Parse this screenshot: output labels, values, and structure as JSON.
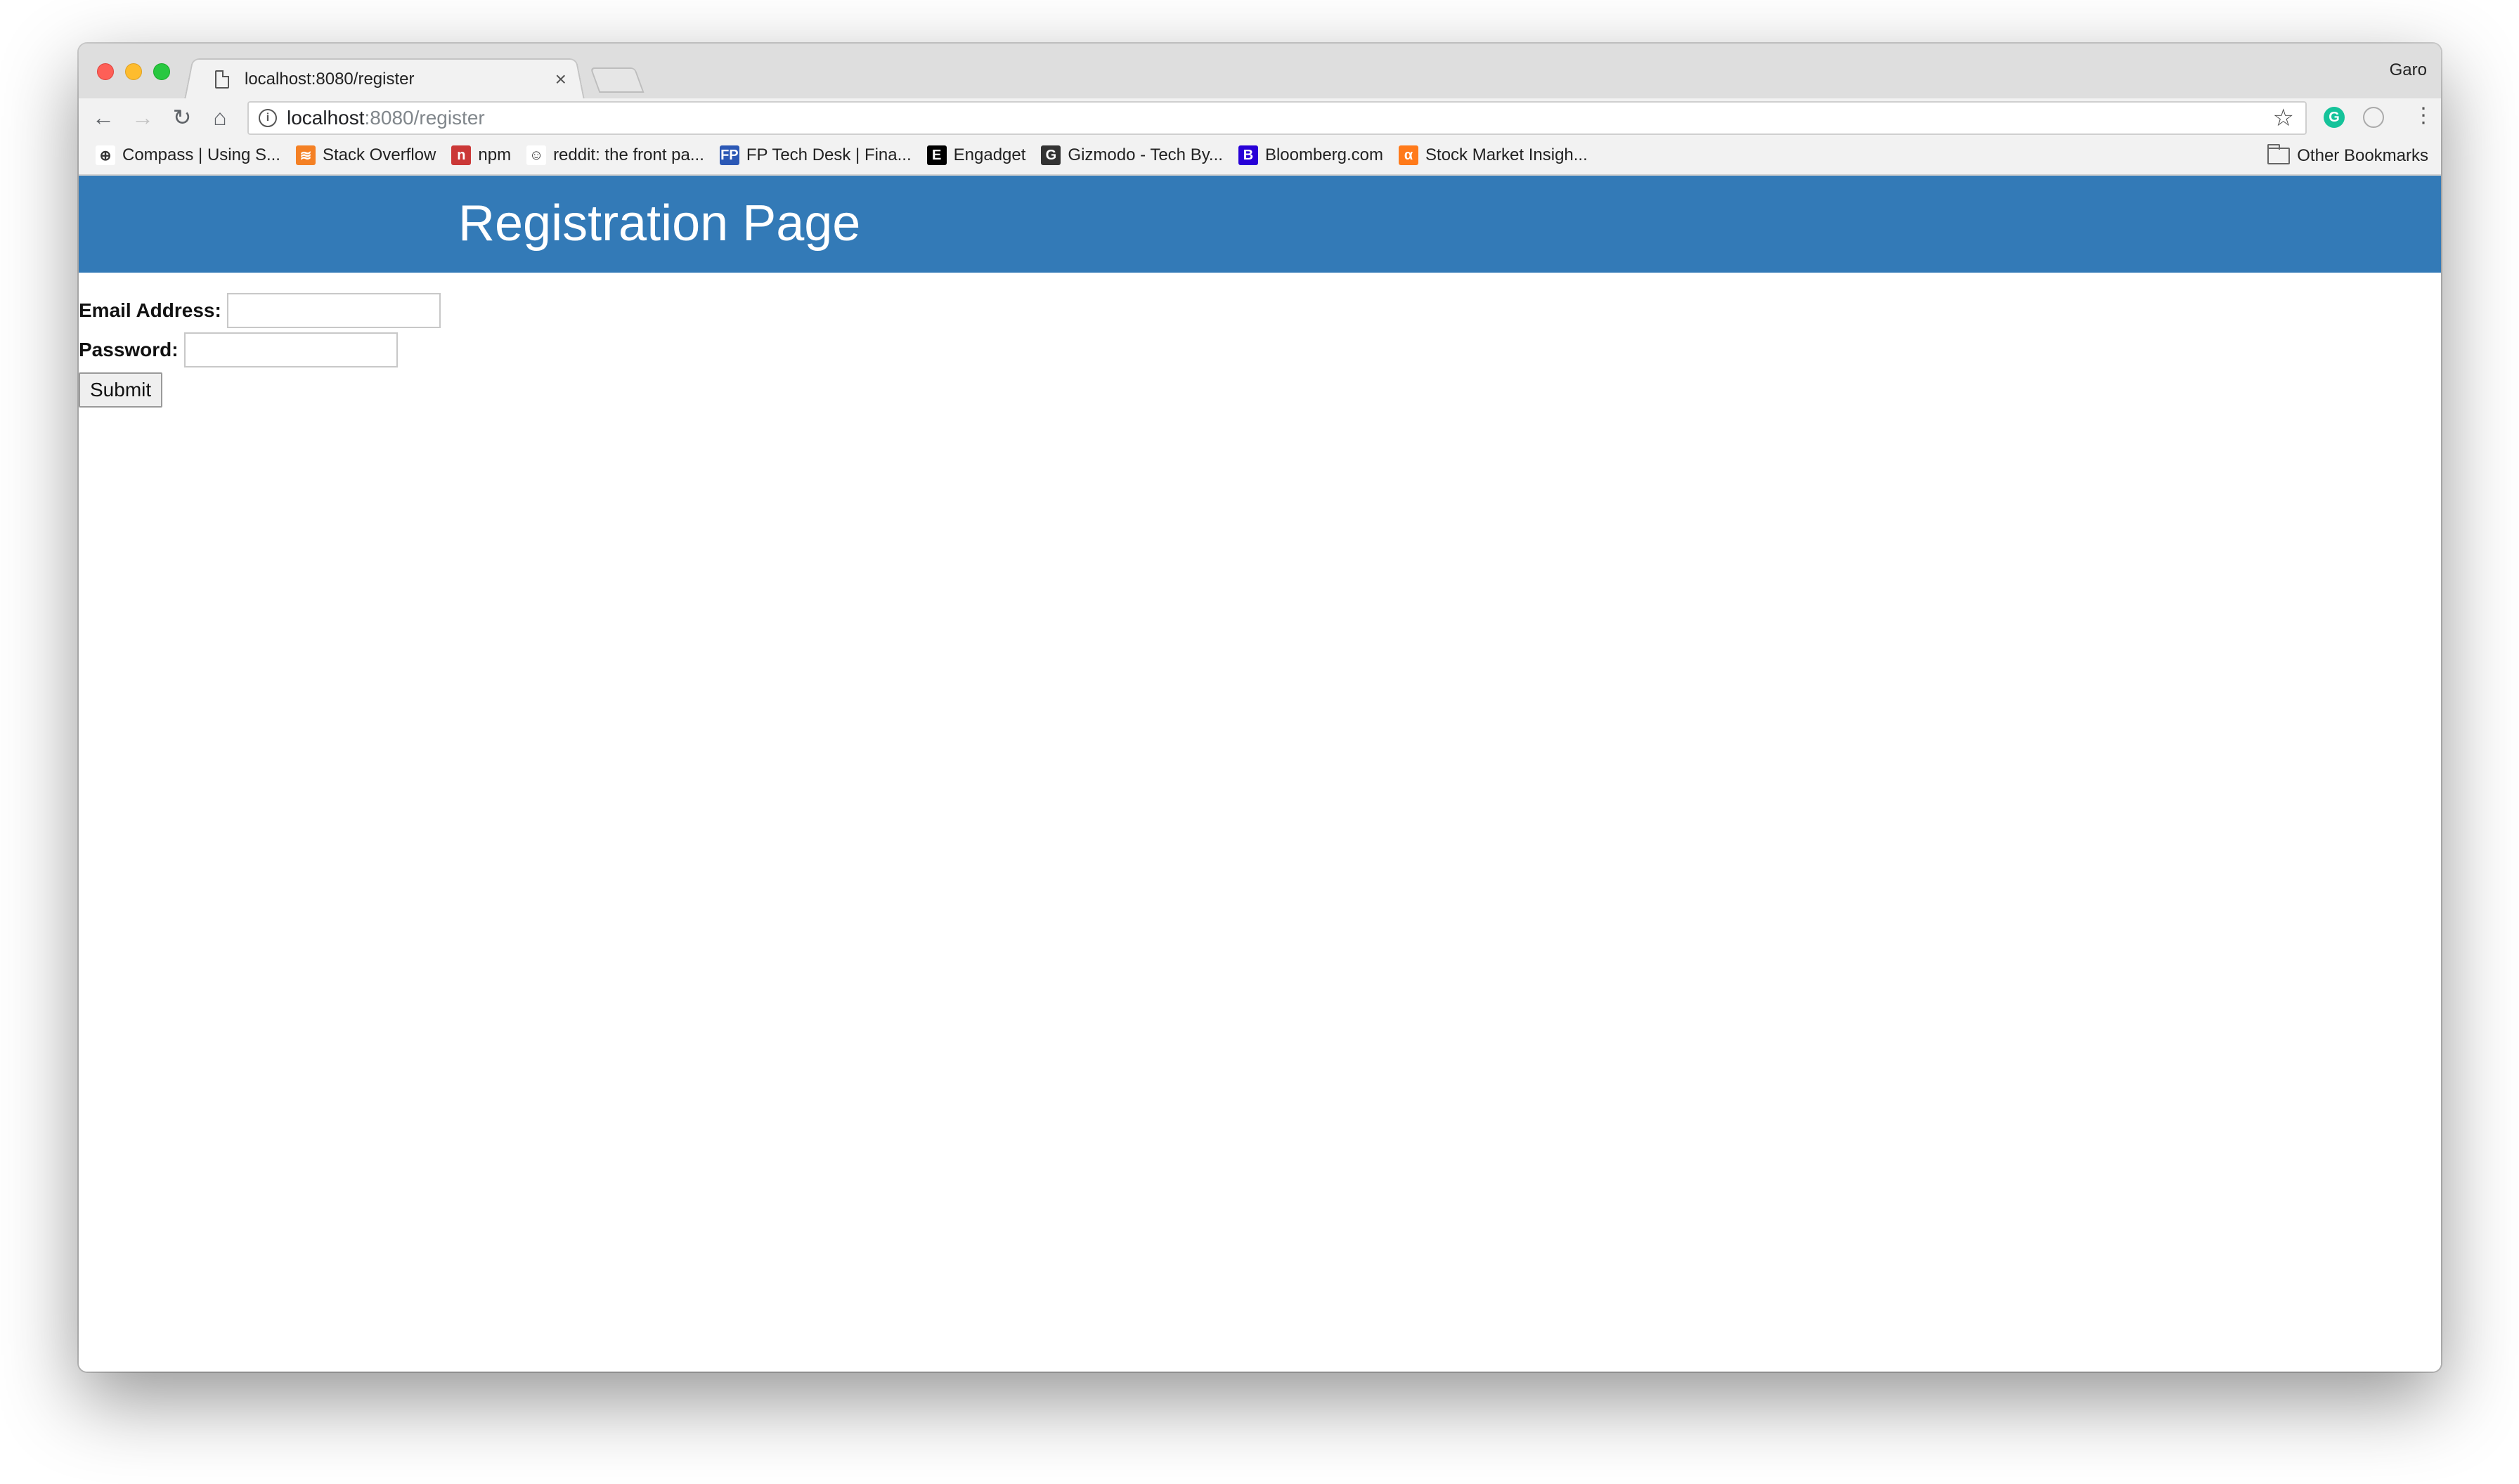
{
  "browser": {
    "tab": {
      "title": "localhost:8080/register",
      "close_glyph": "×"
    },
    "profile_name": "Garo",
    "nav": {
      "back_glyph": "←",
      "forward_glyph": "→",
      "reload_glyph": "↻",
      "home_glyph": "⌂"
    },
    "address": {
      "host": "localhost",
      "path": ":8080/register",
      "info_glyph": "i",
      "star_glyph": "☆"
    },
    "extensions": {
      "grammarly_glyph": "G"
    },
    "menu_glyph": "⋮",
    "bookmarks": [
      {
        "label": "Compass | Using S...",
        "icon": "compass-icon",
        "color": "#ffffff",
        "glyph": "⊕"
      },
      {
        "label": "Stack Overflow",
        "icon": "stackoverflow-icon",
        "color": "#f48024",
        "glyph": "≋"
      },
      {
        "label": "npm",
        "icon": "npm-icon",
        "color": "#cb3837",
        "glyph": "n"
      },
      {
        "label": "reddit: the front pa...",
        "icon": "reddit-icon",
        "color": "#ffffff",
        "glyph": "☺"
      },
      {
        "label": "FP Tech Desk | Fina...",
        "icon": "fp-icon",
        "color": "#2b58b5",
        "glyph": "FP"
      },
      {
        "label": "Engadget",
        "icon": "engadget-icon",
        "color": "#000000",
        "glyph": "E"
      },
      {
        "label": "Gizmodo - Tech By...",
        "icon": "gizmodo-icon",
        "color": "#333333",
        "glyph": "G"
      },
      {
        "label": "Bloomberg.com",
        "icon": "bloomberg-icon",
        "color": "#2800d7",
        "glyph": "B"
      },
      {
        "label": "Stock Market Insigh...",
        "icon": "seekingalpha-icon",
        "color": "#ff7a1a",
        "glyph": "α"
      }
    ],
    "other_bookmarks": "Other Bookmarks"
  },
  "page": {
    "title": "Registration Page",
    "header_color": "#337ab7",
    "form": {
      "email_label": "Email Address:",
      "email_value": "",
      "password_label": "Password:",
      "password_value": "",
      "submit_label": "Submit"
    }
  }
}
